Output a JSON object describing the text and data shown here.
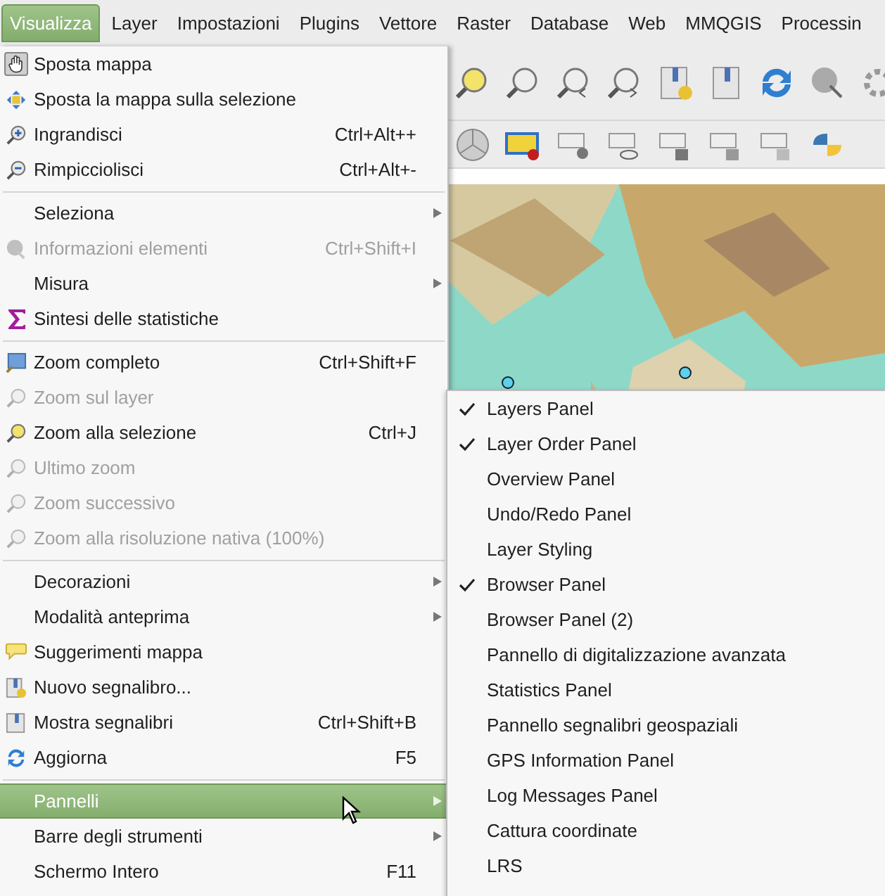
{
  "menubar": [
    {
      "label": "Visualizza",
      "selected": true
    },
    {
      "label": "Layer",
      "selected": false
    },
    {
      "label": "Impostazioni",
      "selected": false
    },
    {
      "label": "Plugins",
      "selected": false
    },
    {
      "label": "Vettore",
      "selected": false
    },
    {
      "label": "Raster",
      "selected": false
    },
    {
      "label": "Database",
      "selected": false
    },
    {
      "label": "Web",
      "selected": false
    },
    {
      "label": "MMQGIS",
      "selected": false
    },
    {
      "label": "Processin",
      "selected": false
    }
  ],
  "menu": [
    {
      "kind": "item",
      "label": "Sposta mappa",
      "checked": true,
      "disabled": false,
      "submenu": false,
      "selected": false
    },
    {
      "kind": "item",
      "label": "Sposta la mappa sulla selezione",
      "checked": false,
      "disabled": false,
      "submenu": false,
      "selected": false
    },
    {
      "kind": "item",
      "label": "Ingrandisci",
      "shortcut": "Ctrl+Alt++",
      "checked": false,
      "disabled": false,
      "submenu": false,
      "selected": false
    },
    {
      "kind": "item",
      "label": "Rimpicciolisci",
      "shortcut": "Ctrl+Alt+-",
      "checked": false,
      "disabled": false,
      "submenu": false,
      "selected": false
    },
    {
      "kind": "separator"
    },
    {
      "kind": "item",
      "label": "Seleziona",
      "checked": false,
      "disabled": false,
      "submenu": true,
      "selected": false
    },
    {
      "kind": "item",
      "label": "Informazioni elementi",
      "shortcut": "Ctrl+Shift+I",
      "checked": false,
      "disabled": true,
      "submenu": false,
      "selected": false
    },
    {
      "kind": "item",
      "label": "Misura",
      "checked": false,
      "disabled": false,
      "submenu": true,
      "selected": false
    },
    {
      "kind": "item",
      "label": "Sintesi delle statistiche",
      "checked": false,
      "disabled": false,
      "submenu": false,
      "selected": false
    },
    {
      "kind": "separator"
    },
    {
      "kind": "item",
      "label": "Zoom completo",
      "shortcut": "Ctrl+Shift+F",
      "checked": false,
      "disabled": false,
      "submenu": false,
      "selected": false
    },
    {
      "kind": "item",
      "label": "Zoom sul layer",
      "checked": false,
      "disabled": true,
      "submenu": false,
      "selected": false
    },
    {
      "kind": "item",
      "label": "Zoom alla selezione",
      "shortcut": "Ctrl+J",
      "checked": false,
      "disabled": false,
      "submenu": false,
      "selected": false
    },
    {
      "kind": "item",
      "label": "Ultimo zoom",
      "checked": false,
      "disabled": true,
      "submenu": false,
      "selected": false
    },
    {
      "kind": "item",
      "label": "Zoom successivo",
      "checked": false,
      "disabled": true,
      "submenu": false,
      "selected": false
    },
    {
      "kind": "item",
      "label": "Zoom alla risoluzione nativa (100%)",
      "checked": false,
      "disabled": true,
      "submenu": false,
      "selected": false
    },
    {
      "kind": "separator"
    },
    {
      "kind": "item",
      "label": "Decorazioni",
      "checked": false,
      "disabled": false,
      "submenu": true,
      "selected": false
    },
    {
      "kind": "item",
      "label": "Modalità anteprima",
      "checked": false,
      "disabled": false,
      "submenu": true,
      "selected": false
    },
    {
      "kind": "item",
      "label": "Suggerimenti mappa",
      "checked": false,
      "disabled": false,
      "submenu": false,
      "selected": false
    },
    {
      "kind": "item",
      "label": "Nuovo segnalibro...",
      "checked": false,
      "disabled": false,
      "submenu": false,
      "selected": false
    },
    {
      "kind": "item",
      "label": "Mostra segnalibri",
      "shortcut": "Ctrl+Shift+B",
      "checked": false,
      "disabled": false,
      "submenu": false,
      "selected": false
    },
    {
      "kind": "item",
      "label": "Aggiorna",
      "shortcut": "F5",
      "checked": false,
      "disabled": false,
      "submenu": false,
      "selected": false
    },
    {
      "kind": "separator"
    },
    {
      "kind": "item",
      "label": "Pannelli",
      "checked": false,
      "disabled": false,
      "submenu": true,
      "selected": true
    },
    {
      "kind": "item",
      "label": "Barre degli strumenti",
      "checked": false,
      "disabled": false,
      "submenu": true,
      "selected": false
    },
    {
      "kind": "item",
      "label": "Schermo Intero",
      "shortcut": "F11",
      "checked": false,
      "disabled": false,
      "submenu": false,
      "selected": false
    }
  ],
  "submenu": [
    {
      "label": "Layers Panel",
      "checked": true
    },
    {
      "label": "Layer Order Panel",
      "checked": true
    },
    {
      "label": "Overview Panel",
      "checked": false
    },
    {
      "label": "Undo/Redo Panel",
      "checked": false
    },
    {
      "label": "Layer Styling",
      "checked": false
    },
    {
      "label": "Browser Panel",
      "checked": true
    },
    {
      "label": "Browser Panel (2)",
      "checked": false
    },
    {
      "label": "Pannello di digitalizzazione avanzata",
      "checked": false
    },
    {
      "label": "Statistics Panel",
      "checked": false
    },
    {
      "label": "Pannello segnalibri geospaziali",
      "checked": false
    },
    {
      "label": "GPS Information Panel",
      "checked": false
    },
    {
      "label": "Log Messages Panel",
      "checked": false
    },
    {
      "label": "Cattura coordinate",
      "checked": false
    },
    {
      "label": "LRS",
      "checked": false
    }
  ]
}
